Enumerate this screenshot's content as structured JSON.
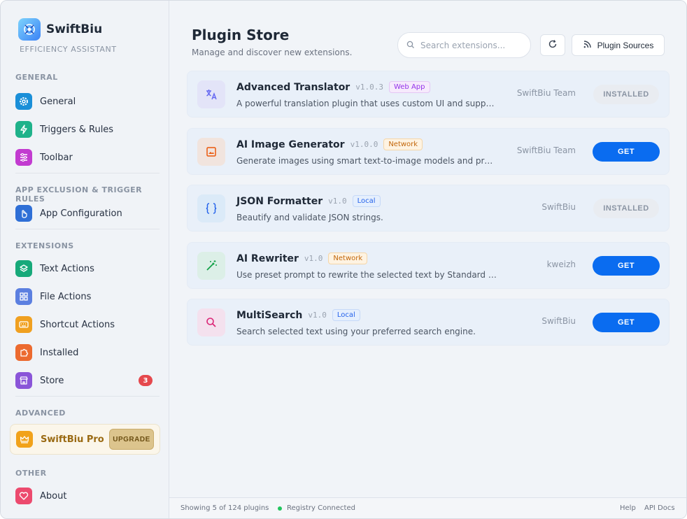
{
  "brand": {
    "name": "SwiftBiu",
    "subtitle": "EFFICIENCY ASSISTANT"
  },
  "sidebar": {
    "sections": {
      "general": "GENERAL",
      "exclusion": "APP EXCLUSION & TRIGGER RULES",
      "extensions": "EXTENSIONS",
      "advanced": "ADVANCED",
      "other": "OTHER"
    },
    "items": {
      "general": {
        "label": "General",
        "icon": "gear-icon",
        "color": "#1a8fd8"
      },
      "triggers": {
        "label": "Triggers & Rules",
        "icon": "bolt-icon",
        "color": "#1fb28a"
      },
      "toolbar": {
        "label": "Toolbar",
        "icon": "sliders-icon",
        "color": "#c23bd0"
      },
      "app_config": {
        "label": "App Configuration",
        "icon": "hand-pointer-icon",
        "color": "#2f6fd6"
      },
      "text_actions": {
        "label": "Text Actions",
        "icon": "layers-icon",
        "color": "#17a97a"
      },
      "file_actions": {
        "label": "File Actions",
        "icon": "grid-icon",
        "color": "#5b7fe0"
      },
      "shortcut_actions": {
        "label": "Shortcut Actions",
        "icon": "keyboard-icon",
        "color": "#f0a020"
      },
      "installed": {
        "label": "Installed",
        "icon": "puzzle-icon",
        "color": "#ec6a2f"
      },
      "store": {
        "label": "Store",
        "icon": "storefront-icon",
        "color": "#8a55d8",
        "badge": "3"
      },
      "pro": {
        "label": "SwiftBiu Pro",
        "icon": "crown-icon",
        "color": "#f1a21a",
        "button": "UPGRADE"
      },
      "about": {
        "label": "About",
        "icon": "heart-icon",
        "color": "#ec4a6e"
      }
    }
  },
  "header": {
    "title": "Plugin Store",
    "subtitle": "Manage and discover new extensions.",
    "search_placeholder": "Search extensions...",
    "sources_label": "Plugin Sources"
  },
  "plugins": [
    {
      "name": "Advanced Translator",
      "version": "v1.0.3",
      "tag": "Web App",
      "tag_type": "webapp",
      "description": "A powerful translation plugin that uses custom UI and supports...",
      "author": "SwiftBiu Team",
      "action": "INSTALLED",
      "icon": "translate-icon"
    },
    {
      "name": "AI Image Generator",
      "version": "v1.0.0",
      "tag": "Network",
      "tag_type": "network",
      "description": "Generate images using smart text-to-image models and preview...",
      "author": "SwiftBiu Team",
      "action": "GET",
      "icon": "image-icon"
    },
    {
      "name": "JSON Formatter",
      "version": "v1.0",
      "tag": "Local",
      "tag_type": "local",
      "description": "Beautify and validate JSON strings.",
      "author": "SwiftBiu",
      "action": "INSTALLED",
      "icon": "braces-icon"
    },
    {
      "name": "AI Rewriter",
      "version": "v1.0",
      "tag": "Network",
      "tag_type": "network",
      "description": "Use preset prompt to rewrite the selected text by Standard AI API",
      "author": "kweizh",
      "action": "GET",
      "icon": "magic-wand-icon"
    },
    {
      "name": "MultiSearch",
      "version": "v1.0",
      "tag": "Local",
      "tag_type": "local",
      "description": "Search selected text using your preferred search engine.",
      "author": "SwiftBiu",
      "action": "GET",
      "icon": "search-icon"
    }
  ],
  "footer": {
    "count": "Showing 5 of 124 plugins",
    "status": "Registry Connected",
    "help": "Help",
    "api_docs": "API Docs"
  }
}
